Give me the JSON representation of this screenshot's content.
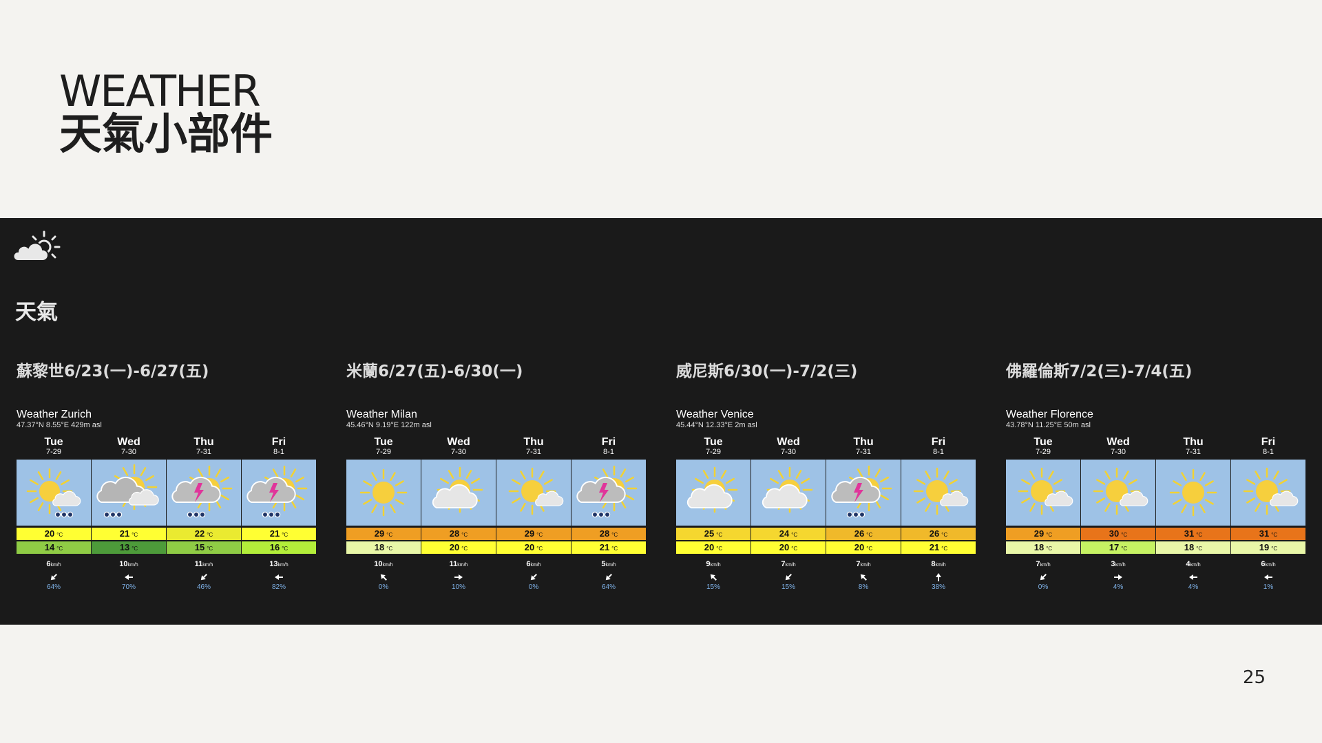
{
  "slide": {
    "title_line1": "WEATHER",
    "title_line2": "天氣小部件",
    "page_number": "25"
  },
  "widget_panel": {
    "logo_icon": "cloud-sun-icon",
    "title": "天氣"
  },
  "temp_unit": "°C",
  "wind_unit": "km/h",
  "rain_unit": "%",
  "temp_colors": {
    "13": "#4d9b3a",
    "14": "#8fcc45",
    "15": "#8fcc45",
    "16": "#b3ee3a",
    "17": "#c6f263",
    "18": "#e9f7a8",
    "19": "#e9f7a8",
    "20": "#ffff33",
    "21": "#ffff33",
    "22": "#eaea30",
    "24": "#f5d72f",
    "25": "#f5d72f",
    "26": "#f0b92a",
    "28": "#ef9e23",
    "29": "#ef9e23",
    "30": "#e8741a",
    "31": "#e8741a"
  },
  "cities": [
    {
      "heading": "蘇黎世6/23(一)-6/27(五)",
      "widget_name": "Weather Zurich",
      "coords": "47.37°N 8.55°E 429m asl",
      "days": [
        {
          "name": "Tue",
          "date": "7-29",
          "icon": "sun-cloud-rain-icon",
          "high": "20",
          "low": "14",
          "wind": "6",
          "wind_dir": "sw",
          "rain": "64"
        },
        {
          "name": "Wed",
          "date": "7-30",
          "icon": "overcast-rain-icon",
          "high": "21",
          "low": "13",
          "wind": "10",
          "wind_dir": "w",
          "rain": "70"
        },
        {
          "name": "Thu",
          "date": "7-31",
          "icon": "thunderstorm-sun-icon",
          "high": "22",
          "low": "15",
          "wind": "11",
          "wind_dir": "sw",
          "rain": "46"
        },
        {
          "name": "Fri",
          "date": "8-1",
          "icon": "thunderstorm-sun-icon",
          "high": "21",
          "low": "16",
          "wind": "13",
          "wind_dir": "w",
          "rain": "82"
        }
      ]
    },
    {
      "heading": "米蘭6/27(五)-6/30(一)",
      "widget_name": "Weather Milan",
      "coords": "45.46°N 9.19°E 122m asl",
      "days": [
        {
          "name": "Tue",
          "date": "7-29",
          "icon": "sun-icon",
          "high": "29",
          "low": "18",
          "wind": "10",
          "wind_dir": "nw",
          "rain": "0"
        },
        {
          "name": "Wed",
          "date": "7-30",
          "icon": "sun-cloud-icon",
          "high": "28",
          "low": "20",
          "wind": "11",
          "wind_dir": "e",
          "rain": "10"
        },
        {
          "name": "Thu",
          "date": "7-31",
          "icon": "sun-small-cloud-icon",
          "high": "29",
          "low": "20",
          "wind": "6",
          "wind_dir": "sw",
          "rain": "0"
        },
        {
          "name": "Fri",
          "date": "8-1",
          "icon": "thunderstorm-sun-icon",
          "high": "28",
          "low": "21",
          "wind": "5",
          "wind_dir": "sw",
          "rain": "64"
        }
      ]
    },
    {
      "heading": "威尼斯6/30(一)-7/2(三)",
      "widget_name": "Weather Venice",
      "coords": "45.44°N 12.33°E 2m asl",
      "days": [
        {
          "name": "Tue",
          "date": "7-29",
          "icon": "sun-cloud-icon",
          "high": "25",
          "low": "20",
          "wind": "9",
          "wind_dir": "nw",
          "rain": "15"
        },
        {
          "name": "Wed",
          "date": "7-30",
          "icon": "sun-cloud-icon",
          "high": "24",
          "low": "20",
          "wind": "7",
          "wind_dir": "sw",
          "rain": "15"
        },
        {
          "name": "Thu",
          "date": "7-31",
          "icon": "thunderstorm-sun-icon",
          "high": "26",
          "low": "20",
          "wind": "7",
          "wind_dir": "nw",
          "rain": "8"
        },
        {
          "name": "Fri",
          "date": "8-1",
          "icon": "sun-small-cloud-icon",
          "high": "26",
          "low": "21",
          "wind": "8",
          "wind_dir": "n",
          "rain": "38"
        }
      ]
    },
    {
      "heading": "佛羅倫斯7/2(三)-7/4(五)",
      "widget_name": "Weather Florence",
      "coords": "43.78°N 11.25°E 50m asl",
      "days": [
        {
          "name": "Tue",
          "date": "7-29",
          "icon": "sun-small-cloud-icon",
          "high": "29",
          "low": "18",
          "wind": "7",
          "wind_dir": "sw",
          "rain": "0"
        },
        {
          "name": "Wed",
          "date": "7-30",
          "icon": "sun-small-cloud-icon",
          "high": "30",
          "low": "17",
          "wind": "3",
          "wind_dir": "e",
          "rain": "4"
        },
        {
          "name": "Thu",
          "date": "7-31",
          "icon": "sun-icon",
          "high": "31",
          "low": "18",
          "wind": "4",
          "wind_dir": "w",
          "rain": "4"
        },
        {
          "name": "Fri",
          "date": "8-1",
          "icon": "sun-small-cloud-icon",
          "high": "31",
          "low": "19",
          "wind": "6",
          "wind_dir": "w",
          "rain": "1"
        }
      ]
    }
  ]
}
